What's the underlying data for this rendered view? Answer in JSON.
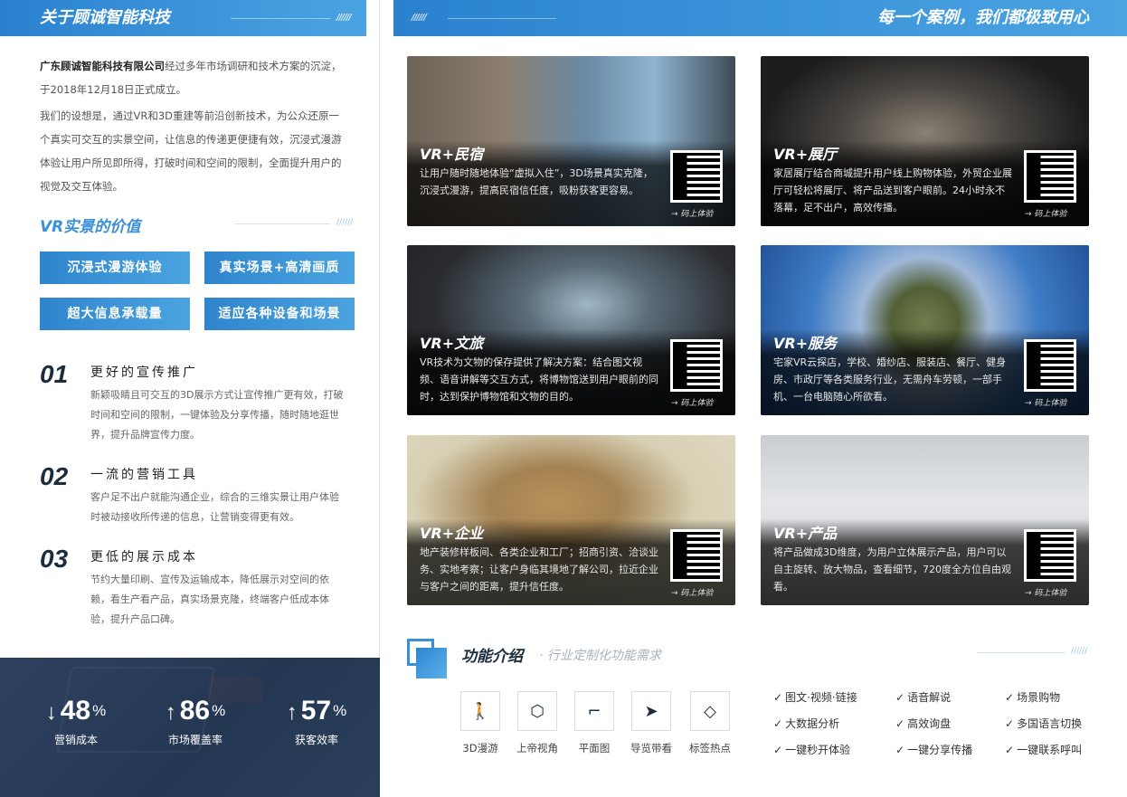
{
  "left": {
    "header_title": "关于顾诚智能科技",
    "intro_company": "广东顾诚智能科技有限公司",
    "intro_p1": "经过多年市场调研和技术方案的沉淀，于2018年12月18日正式成立。",
    "intro_p2": "我们的设想是，通过VR和3D重建等前沿创新技术，为公众还原一个真实可交互的实景空间，让信息的传递更便捷有效，沉浸式漫游体验让用户所见即所得，打破时间和空间的限制，全面提升用户的视觉及交互体验。",
    "value_title": "VR实景的价值",
    "value_buttons": [
      "沉浸式漫游体验",
      "真实场景+高清画质",
      "超大信息承载量",
      "适应各种设备和场景"
    ],
    "items": [
      {
        "num": "01",
        "title": "更好的宣传推广",
        "desc": "新颖吸睛且可交互的3D展示方式让宣传推广更有效，打破时间和空间的限制，一键体验及分享传播，随时随地逛世界，提升品牌宣传力度。"
      },
      {
        "num": "02",
        "title": "一流的营销工具",
        "desc": "客户足不出户就能沟通企业，综合的三维实景让用户体验时被动接收所传递的信息，让营销变得更有效。"
      },
      {
        "num": "03",
        "title": "更低的展示成本",
        "desc": "节约大量印刷、宣传及运输成本，降低展示对空间的依赖，看生产看产品，真实场景克隆，终端客户低成本体验，提升产品口碑。"
      }
    ],
    "stats": [
      {
        "arrow": "↓",
        "value": "48",
        "unit": "%",
        "label": "营销成本"
      },
      {
        "arrow": "↑",
        "value": "86",
        "unit": "%",
        "label": "市场覆盖率"
      },
      {
        "arrow": "↑",
        "value": "57",
        "unit": "%",
        "label": "获客效率"
      }
    ]
  },
  "right": {
    "header_title": "每一个案例，我们都极致用心",
    "qr_label": "→ 码上体验",
    "cases": [
      {
        "title": "VR+民宿",
        "desc": "让用户随时随地体验“虚拟入住”，3D场景真实克隆，沉浸式漫游，提高民宿信任度，吸粉获客更容易。"
      },
      {
        "title": "VR+展厅",
        "desc": "家居展厅结合商城提升用户线上购物体验，外贸企业展厅可轻松将展厅、将产品送到客户眼前。24小时永不落幕，足不出户，高效传播。"
      },
      {
        "title": "VR+文旅",
        "desc": "VR技术为文物的保存提供了解决方案：结合图文视频、语音讲解等交互方式，将博物馆送到用户眼前的同时，达到保护博物馆和文物的目的。"
      },
      {
        "title": "VR+服务",
        "desc": "宅家VR云探店，学校、婚纱店、服装店、餐厅、健身房、市政厅等各类服务行业，无需舟车劳顿，一部手机、一台电脑随心所欲看。"
      },
      {
        "title": "VR+企业",
        "desc": "地产装修样板间、各类企业和工厂；招商引资、洽谈业务、实地考察；让客户身临其境地了解公司，拉近企业与客户之间的距离，提升信任度。"
      },
      {
        "title": "VR+产品",
        "desc": "将产品做成3D维度，为用户立体展示产品，用户可以自主旋转、放大物品，查看细节，720度全方位自由观看。"
      }
    ],
    "features": {
      "title": "功能介绍",
      "subtitle": "· 行业定制化功能需求",
      "icons": [
        {
          "icon": "walk-icon",
          "label": "3D漫游"
        },
        {
          "icon": "cube-icon",
          "label": "上帝视角"
        },
        {
          "icon": "floorplan-icon",
          "label": "平面图"
        },
        {
          "icon": "send-icon",
          "label": "导览带看"
        },
        {
          "icon": "tag-icon",
          "label": "标签热点"
        }
      ],
      "checks": [
        "图文·视频·链接",
        "语音解说",
        "场景购物",
        "大数据分析",
        "高效询盘",
        "多国语言切换",
        "一键秒开体验",
        "一键分享传播",
        "一键联系呼叫"
      ]
    }
  }
}
